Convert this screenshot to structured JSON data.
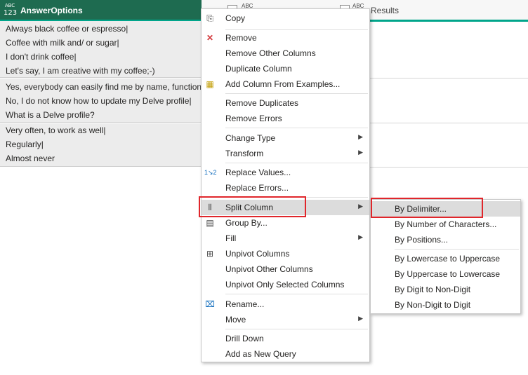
{
  "columns": [
    {
      "type_top": "ABC",
      "type_bottom": "123",
      "label": "AnswerOptions"
    },
    {
      "type_top": "ABC",
      "label": ""
    },
    {
      "type_top": "ABC",
      "label": "Results"
    }
  ],
  "groups": [
    {
      "rows": [
        "Always black coffee or espresso|",
        "Coffee with milk and/ or sugar|",
        "I don't drink coffee|",
        "Let's say, I am creative with my coffee;-)"
      ]
    },
    {
      "rows": [
        "Yes, everybody can easily find me by name, function or skills",
        "No, I do not know how to update my Delve profile|",
        "What is a Delve profile?"
      ]
    },
    {
      "rows": [
        "Very often, to work as well|",
        "Regularly|",
        "Almost never"
      ]
    }
  ],
  "context_menu": {
    "copy": "Copy",
    "remove": "Remove",
    "remove_other": "Remove Other Columns",
    "duplicate": "Duplicate Column",
    "add_from_examples": "Add Column From Examples...",
    "remove_duplicates": "Remove Duplicates",
    "remove_errors": "Remove Errors",
    "change_type": "Change Type",
    "transform": "Transform",
    "replace_values": "Replace Values...",
    "replace_errors": "Replace Errors...",
    "split_column": "Split Column",
    "group_by": "Group By...",
    "fill": "Fill",
    "unpivot": "Unpivot Columns",
    "unpivot_other": "Unpivot Other Columns",
    "unpivot_selected": "Unpivot Only Selected Columns",
    "rename": "Rename...",
    "move": "Move",
    "drill_down": "Drill Down",
    "add_as_query": "Add as New Query"
  },
  "submenu": {
    "by_delimiter": "By Delimiter...",
    "by_num_chars": "By Number of Characters...",
    "by_positions": "By Positions...",
    "lower_to_upper": "By Lowercase to Uppercase",
    "upper_to_lower": "By Uppercase to Lowercase",
    "digit_to_nondigit": "By Digit to Non-Digit",
    "nondigit_to_digit": "By Non-Digit to Digit"
  },
  "colors": {
    "header_selected": "#1e6b50",
    "accent": "#00a58b",
    "highlight_box": "#e0262b"
  }
}
